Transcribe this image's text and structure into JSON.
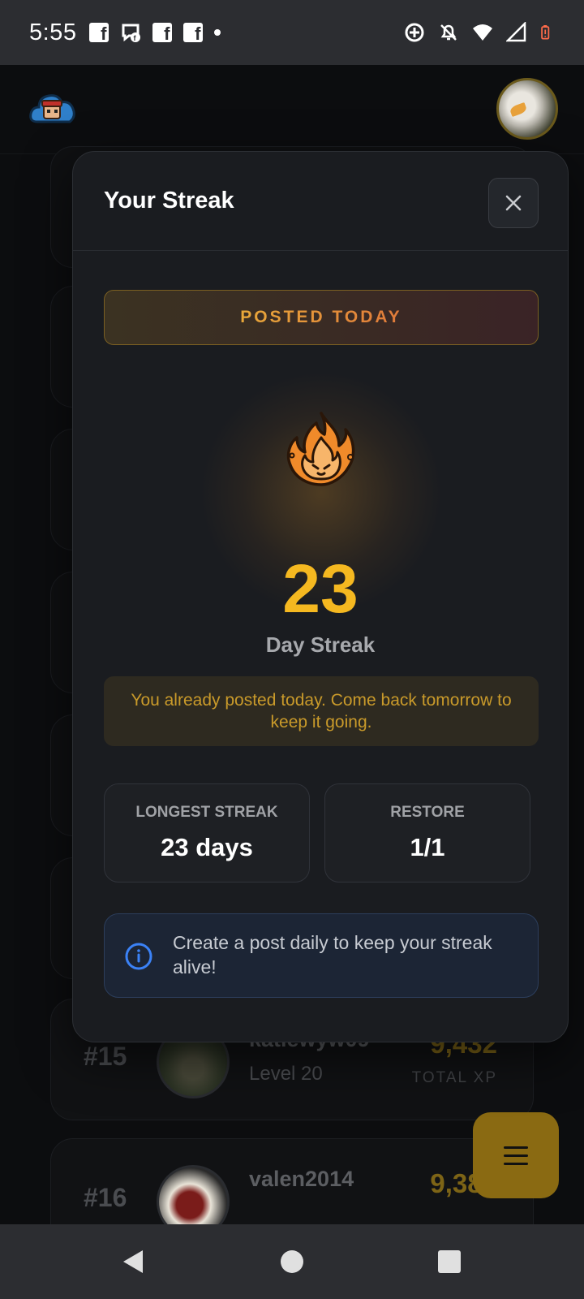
{
  "status_bar": {
    "time": "5:55",
    "left_icons": [
      "facebook-icon",
      "messenger-icon",
      "facebook-icon",
      "facebook-icon",
      "dot-icon"
    ],
    "right_icons": [
      "sync-icon",
      "bell-off-icon",
      "wifi-icon",
      "signal-icon",
      "battery-low-icon"
    ]
  },
  "modal": {
    "title": "Your Streak",
    "badge": "POSTED TODAY",
    "streak_count": "23",
    "streak_label": "Day Streak",
    "notice": "You already posted today. Come back tomorrow to keep it going.",
    "stats": [
      {
        "label": "LONGEST STREAK",
        "value": "23 days"
      },
      {
        "label": "RESTORE",
        "value": "1/1"
      }
    ],
    "info": "Create a post daily to keep your streak alive!"
  },
  "leaderboard": [
    {
      "rank": "#15",
      "name": "katiewyw09",
      "level": "Level 20",
      "xp": "9,432",
      "xp_label": "TOTAL XP"
    },
    {
      "rank": "#16",
      "name": "valen2014",
      "level": "",
      "xp": "9,382",
      "xp_label": ""
    }
  ],
  "colors": {
    "accent": "#f5b820",
    "badge_text": "#e8a83a",
    "info_blue": "#3b82f6",
    "fab": "#8a6a12"
  }
}
